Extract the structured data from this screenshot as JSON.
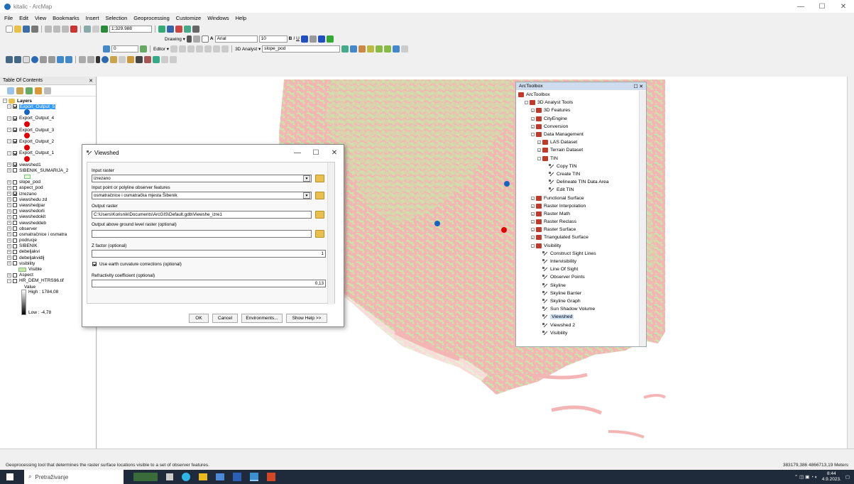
{
  "app": {
    "title": "kitalic - ArcMap"
  },
  "menu": [
    "File",
    "Edit",
    "View",
    "Bookmarks",
    "Insert",
    "Selection",
    "Geoprocessing",
    "Customize",
    "Windows",
    "Help"
  ],
  "toolbar": {
    "scale": "1:329.988",
    "drawing_label": "Drawing ▾",
    "font": "Arial",
    "font_size": "10",
    "editor_label": "Editor ▾",
    "analyst_label": "3D Analyst ▾",
    "layer_combo": "slope_pod",
    "georef_value": "0"
  },
  "toc": {
    "title": "Table Of Contents",
    "layers_group": "Layers",
    "items": [
      {
        "label": "Export_Output_5",
        "checked": true,
        "selected": true,
        "dot": "#1565c0"
      },
      {
        "label": "Export_Output_4",
        "checked": true,
        "dot": "#e00000"
      },
      {
        "label": "Export_Output_3",
        "checked": true,
        "dot": "#e00000"
      },
      {
        "label": "Export_Output_2",
        "checked": true,
        "dot": "#e00000"
      },
      {
        "label": "Export_Output_1",
        "checked": true,
        "dot": "#e00000"
      },
      {
        "label": "viewshed1",
        "checked": true
      },
      {
        "label": "SIBENIK_SUMARIJA_2",
        "checked": false
      },
      {
        "label": "slope_pod",
        "checked": false
      },
      {
        "label": "aspect_pod",
        "checked": false
      },
      {
        "label": "izrezano",
        "checked": true
      },
      {
        "label": "viewshedu zd",
        "checked": false
      },
      {
        "label": "viewshedpar",
        "checked": false
      },
      {
        "label": "viewshedorli",
        "checked": false
      },
      {
        "label": "viewshedokit",
        "checked": false
      },
      {
        "label": "viewsheddeb",
        "checked": false
      },
      {
        "label": "observer",
        "checked": false
      },
      {
        "label": "osmatračnice i osmatra",
        "checked": false
      },
      {
        "label": "podrucje",
        "checked": false
      },
      {
        "label": "SIBENIK",
        "checked": false
      },
      {
        "label": "debeljakvi",
        "checked": false
      },
      {
        "label": "debeljakvidlj",
        "checked": false
      },
      {
        "label": "visibility",
        "checked": false
      }
    ],
    "visible_label": "Visible",
    "aspect": "Aspect",
    "dem": "HR_DEM_HTRS96.tif",
    "value": "Value",
    "high": "High : 1784,08",
    "low": "Low : -4,78"
  },
  "dialog": {
    "title": "Viewshed",
    "input_raster_label": "Input raster",
    "input_raster": "izrezano",
    "observer_label": "Input point or polyline observer features",
    "observer": "osmatračnice i osmatračka mjesta Šibenik",
    "output_label": "Output raster",
    "output": "C:\\Users\\Korisnik\\Documents\\ArcGIS\\Default.gdb\\Viewshe_izre1",
    "agl_label": "Output above ground level raster (optional)",
    "agl": "",
    "z_label": "Z factor (optional)",
    "z": "1",
    "curvature_label": "Use earth curvature corrections (optional)",
    "refr_label": "Refractivity coefficient (optional)",
    "refr": "0,13",
    "ok": "OK",
    "cancel": "Cancel",
    "env": "Environments...",
    "help": "Show Help >>"
  },
  "toolbox": {
    "title": "ArcToolbox",
    "items": [
      {
        "label": "ArcToolbox",
        "lvl": 0,
        "icon": "toolbox"
      },
      {
        "label": "3D Analyst Tools",
        "lvl": 1,
        "icon": "toolbox",
        "exp": "-"
      },
      {
        "label": "3D Features",
        "lvl": 2,
        "icon": "toolset",
        "exp": "+"
      },
      {
        "label": "CityEngine",
        "lvl": 2,
        "icon": "toolset",
        "exp": "+"
      },
      {
        "label": "Conversion",
        "lvl": 2,
        "icon": "toolset",
        "exp": "+"
      },
      {
        "label": "Data Management",
        "lvl": 2,
        "icon": "toolset",
        "exp": "-"
      },
      {
        "label": "LAS Dataset",
        "lvl": 3,
        "icon": "toolset",
        "exp": "+"
      },
      {
        "label": "Terrain Dataset",
        "lvl": 3,
        "icon": "toolset",
        "exp": "+"
      },
      {
        "label": "TIN",
        "lvl": 3,
        "icon": "toolset",
        "exp": "-"
      },
      {
        "label": "Copy TIN",
        "lvl": 4,
        "icon": "tool"
      },
      {
        "label": "Create TIN",
        "lvl": 4,
        "icon": "tool"
      },
      {
        "label": "Delineate TIN Data Area",
        "lvl": 4,
        "icon": "tool"
      },
      {
        "label": "Edit TIN",
        "lvl": 4,
        "icon": "tool"
      },
      {
        "label": "Functional Surface",
        "lvl": 2,
        "icon": "toolset",
        "exp": "+"
      },
      {
        "label": "Raster Interpolation",
        "lvl": 2,
        "icon": "toolset",
        "exp": "+"
      },
      {
        "label": "Raster Math",
        "lvl": 2,
        "icon": "toolset",
        "exp": "+"
      },
      {
        "label": "Raster Reclass",
        "lvl": 2,
        "icon": "toolset",
        "exp": "+"
      },
      {
        "label": "Raster Surface",
        "lvl": 2,
        "icon": "toolset",
        "exp": "+"
      },
      {
        "label": "Triangulated Surface",
        "lvl": 2,
        "icon": "toolset",
        "exp": "+"
      },
      {
        "label": "Visibility",
        "lvl": 2,
        "icon": "toolset",
        "exp": "-"
      },
      {
        "label": "Construct Sight Lines",
        "lvl": 3,
        "icon": "tool"
      },
      {
        "label": "Intervisibility",
        "lvl": 3,
        "icon": "tool"
      },
      {
        "label": "Line Of Sight",
        "lvl": 3,
        "icon": "tool"
      },
      {
        "label": "Observer Points",
        "lvl": 3,
        "icon": "tool"
      },
      {
        "label": "Skyline",
        "lvl": 3,
        "icon": "tool"
      },
      {
        "label": "Skyline Barrier",
        "lvl": 3,
        "icon": "tool"
      },
      {
        "label": "Skyline Graph",
        "lvl": 3,
        "icon": "tool"
      },
      {
        "label": "Sun Shadow Volume",
        "lvl": 3,
        "icon": "tool"
      },
      {
        "label": "Viewshed",
        "lvl": 3,
        "icon": "tool",
        "hl": true
      },
      {
        "label": "Viewshed 2",
        "lvl": 3,
        "icon": "tool"
      },
      {
        "label": "Visibility",
        "lvl": 3,
        "icon": "tool"
      }
    ]
  },
  "status": {
    "message": "Geoprocessing tool that determines the raster surface locations visible to a set of observer features.",
    "coords": "383179,386  4866713,19 Meters"
  },
  "taskbar": {
    "search": "Pretraživanje",
    "time": "8:44",
    "date": "4.9.2023."
  },
  "colors": {
    "visible_pink": "#f4b6b4",
    "visible_green": "#c9e6a9",
    "accent": "#3399ff"
  }
}
